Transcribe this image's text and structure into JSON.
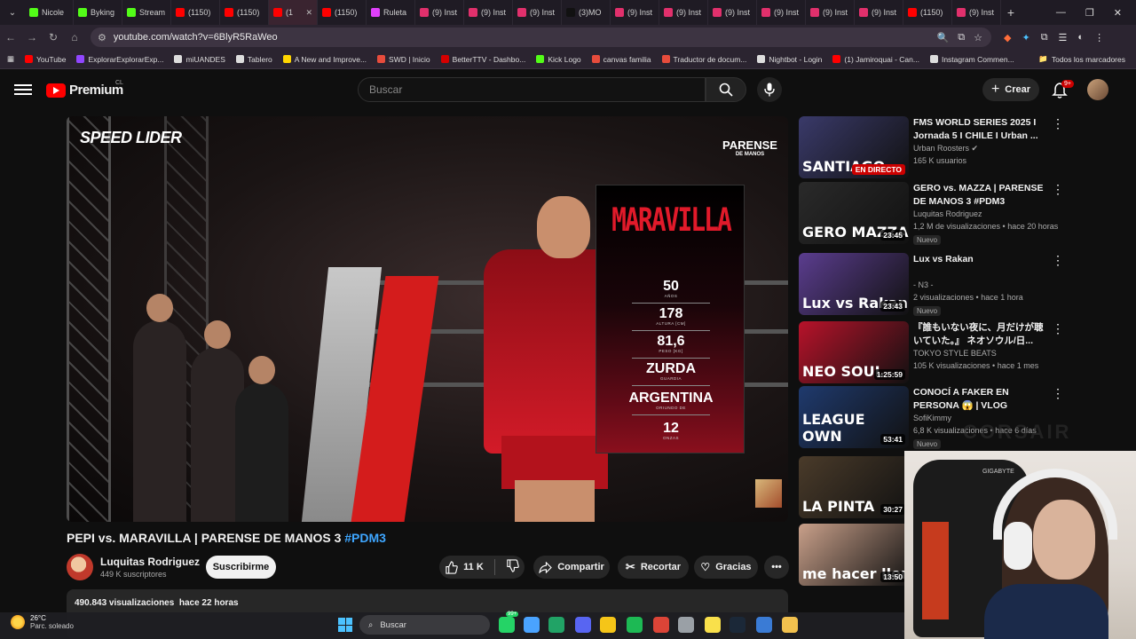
{
  "browser": {
    "tabs": [
      {
        "label": "Nicole",
        "color": "#53fc18"
      },
      {
        "label": "Byking",
        "color": "#53fc18"
      },
      {
        "label": "Stream",
        "color": "#53fc18"
      },
      {
        "label": "(1150)",
        "color": "#ff0000"
      },
      {
        "label": "(1150)",
        "color": "#ff0000"
      },
      {
        "label": "(1",
        "color": "#ff0000",
        "active": true
      },
      {
        "label": "(1150)",
        "color": "#ff0000"
      },
      {
        "label": "Ruleta",
        "color": "#e040fb"
      },
      {
        "label": "(9) Inst",
        "color": "#e1306c"
      },
      {
        "label": "(9) Inst",
        "color": "#e1306c"
      },
      {
        "label": "(9) Inst",
        "color": "#e1306c"
      },
      {
        "label": "(3)MO",
        "color": "#111111"
      },
      {
        "label": "(9) Inst",
        "color": "#e1306c"
      },
      {
        "label": "(9) Inst",
        "color": "#e1306c"
      },
      {
        "label": "(9) Inst",
        "color": "#e1306c"
      },
      {
        "label": "(9) Inst",
        "color": "#e1306c"
      },
      {
        "label": "(9) Inst",
        "color": "#e1306c"
      },
      {
        "label": "(9) Inst",
        "color": "#e1306c"
      },
      {
        "label": "(1150)",
        "color": "#ff0000"
      },
      {
        "label": "(9) Inst",
        "color": "#e1306c"
      }
    ],
    "url": "youtube.com/watch?v=6BlyR5RaWeo",
    "bookmarks": [
      {
        "label": "YouTube",
        "color": "#ff0000"
      },
      {
        "label": "ExplorarExplorarExp...",
        "color": "#9146ff"
      },
      {
        "label": "miUANDES",
        "color": "#dddddd"
      },
      {
        "label": "Tablero",
        "color": "#dddddd"
      },
      {
        "label": "A New and Improve...",
        "color": "#ffd600"
      },
      {
        "label": "SWD | Inicio",
        "color": "#e74c3c"
      },
      {
        "label": "BetterTTV - Dashbo...",
        "color": "#d50000"
      },
      {
        "label": "Kick Logo",
        "color": "#53fc18"
      },
      {
        "label": "canvas familia",
        "color": "#e74c3c"
      },
      {
        "label": "Traductor de docum...",
        "color": "#e74c3c"
      },
      {
        "label": "Nightbot - Login",
        "color": "#dddddd"
      },
      {
        "label": "(1) Jamiroquai - Can...",
        "color": "#ff0000"
      },
      {
        "label": "Instagram Commen...",
        "color": "#dddddd"
      }
    ],
    "all_bookmarks": "Todos los marcadores"
  },
  "yt": {
    "logo_text": "Premium",
    "country": "CL",
    "search_placeholder": "Buscar",
    "create_label": "Crear",
    "notif_count": "9+"
  },
  "player": {
    "logo_left": "SPEED LIDER",
    "logo_right_1": "PARENSE",
    "logo_right_2": "DE MANOS",
    "fighter_name": "MARAVILLA",
    "stats": [
      {
        "value": "50",
        "label": "AÑOS"
      },
      {
        "value": "178",
        "label": "ALTURA [CM]"
      },
      {
        "value": "81,6",
        "label": "PESO [KG]"
      },
      {
        "value": "ZURDA",
        "label": "GUARDIA"
      },
      {
        "value": "ARGENTINA",
        "label": "ORIUNDO DE"
      },
      {
        "value": "12",
        "label": "ONZAS"
      }
    ]
  },
  "video": {
    "title": "PEPI vs. MARAVILLA | PARENSE DE MANOS 3 ",
    "hashtag": "#PDM3",
    "channel": "Luquitas Rodriguez",
    "subscribers": "449 K suscriptores",
    "subscribe_label": "Suscribirme",
    "likes": "11 K",
    "share_label": "Compartir",
    "clip_label": "Recortar",
    "thanks_label": "Gracias",
    "views": "490.843 visualizaciones",
    "age": "hace 22 horas"
  },
  "recommendations": [
    {
      "title": "FMS WORLD SERIES 2025 I Jornada 5 I CHILE I Urban ...",
      "channel": "Urban Roosters",
      "verified": true,
      "meta": "165 K usuarios",
      "live": "EN DIRECTO",
      "thumb_text": "SANTIAGO",
      "bg": "#3a3a6a"
    },
    {
      "title": "GERO vs. MAZZA | PARENSE DE MANOS 3 #PDM3",
      "channel": "Luquitas Rodriguez",
      "meta": "1,2 M de visualizaciones • hace 20 horas",
      "duration": "23:45",
      "new": "Nuevo",
      "thumb_text": "GERO MAZZA",
      "bg": "#2a2a2a"
    },
    {
      "title": "Lux vs Rakan",
      "channel": "- N3 -",
      "meta": "2 visualizaciones • hace 1 hora",
      "duration": "23:43",
      "new": "Nuevo",
      "thumb_text": "Lux vs Rakan",
      "bg": "#5b3d8f"
    },
    {
      "title": "『誰もいない夜に、月だけが聴いていた。』 ネオソウル/日...",
      "channel": "TOKYO STYLE BEATS",
      "meta": "105 K visualizaciones • hace 1 mes",
      "duration": "1:25:59",
      "thumb_text": "NEO SOUL",
      "bg": "#b8122a"
    },
    {
      "title": "CONOCÍ A FAKER EN PERSONA 😱 | VLOG ALEMANIA + ...",
      "channel": "SofiKimmy",
      "meta": "6,8 K visualizaciones • hace 6 días",
      "duration": "53:41",
      "new": "Nuevo",
      "thumb_text": "LEAGUE OWN",
      "bg": "#1f3a6e"
    },
    {
      "title": "",
      "channel": "",
      "meta": "",
      "duration": "30:27",
      "thumb_text": "LA PINTA",
      "bg": "#4a3b2a"
    },
    {
      "title": "",
      "channel": "",
      "meta": "",
      "duration": "13:50",
      "thumb_text": "me hacer llor",
      "bg": "#c9a08a"
    }
  ],
  "stream_overlay": {
    "brand": "CORSAIR",
    "chair_brand": "GIGABYTE"
  },
  "taskbar": {
    "temperature": "26°C",
    "weather": "Parc. soleado",
    "search_label": "Buscar",
    "icons": [
      "whatsapp-icon",
      "notes-icon",
      "excel-icon",
      "discord-icon",
      "explorer-icon",
      "spotify-icon",
      "chrome-icon",
      "steam-community-icon",
      "sticky-icon",
      "steam-icon",
      "edge-icon",
      "app-icon"
    ],
    "whatsapp_badge": "99+"
  }
}
